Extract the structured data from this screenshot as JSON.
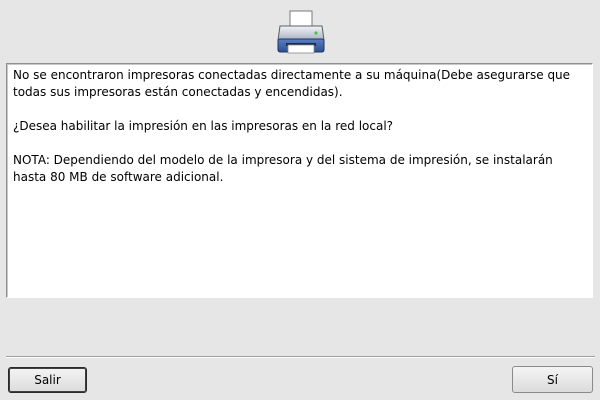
{
  "icon": {
    "name": "printer-icon"
  },
  "message": {
    "paragraph1": "No se encontraron impresoras conectadas directamente a su máquina(Debe asegurarse que todas sus impresoras están conectadas y encendidas).",
    "paragraph2": "¿Desea habilitar la impresión en las impresoras en la red local?",
    "paragraph3": "NOTA: Dependiendo del modelo de la impresora y del sistema de impresión, se instalarán hasta 80 MB de software adicional."
  },
  "buttons": {
    "exit_label": "Salir",
    "yes_label": "Sí"
  }
}
